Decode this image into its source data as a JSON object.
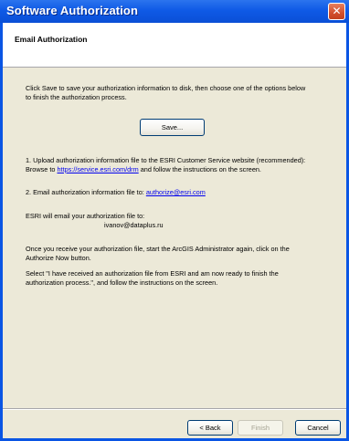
{
  "window": {
    "title": "Software Authorization",
    "close_glyph": "✕"
  },
  "header": {
    "title": "Email Authorization"
  },
  "content": {
    "intro_line1": "Click Save to save your authorization information to disk, then choose one of the options below",
    "intro_line2": "to finish the authorization process.",
    "save_button": "Save...",
    "option1_line1": "1.  Upload authorization information file to the ESRI Customer Service website (recommended):",
    "option1_prefix": "Browse to ",
    "option1_link": "https://service.esri.com/drm",
    "option1_suffix": " and follow the instructions on the screen.",
    "option2_prefix": "2.  Email authorization information file to: ",
    "option2_link": "authorize@esri.com",
    "esri_email_line": "ESRI will email your authorization file to:",
    "user_email": "ivanov@dataplus.ru",
    "receive_line1": "Once you receive your authorization file, start the ArcGIS Administrator again, click on the",
    "receive_line2": "Authorize Now button.",
    "select_line1": "Select \"I have received an authorization file from ESRI and am now ready to finish the",
    "select_line2": "authorization process.\", and follow the instructions on the screen."
  },
  "footer": {
    "back_label": "< Back",
    "finish_label": "Finish",
    "cancel_label": "Cancel"
  }
}
